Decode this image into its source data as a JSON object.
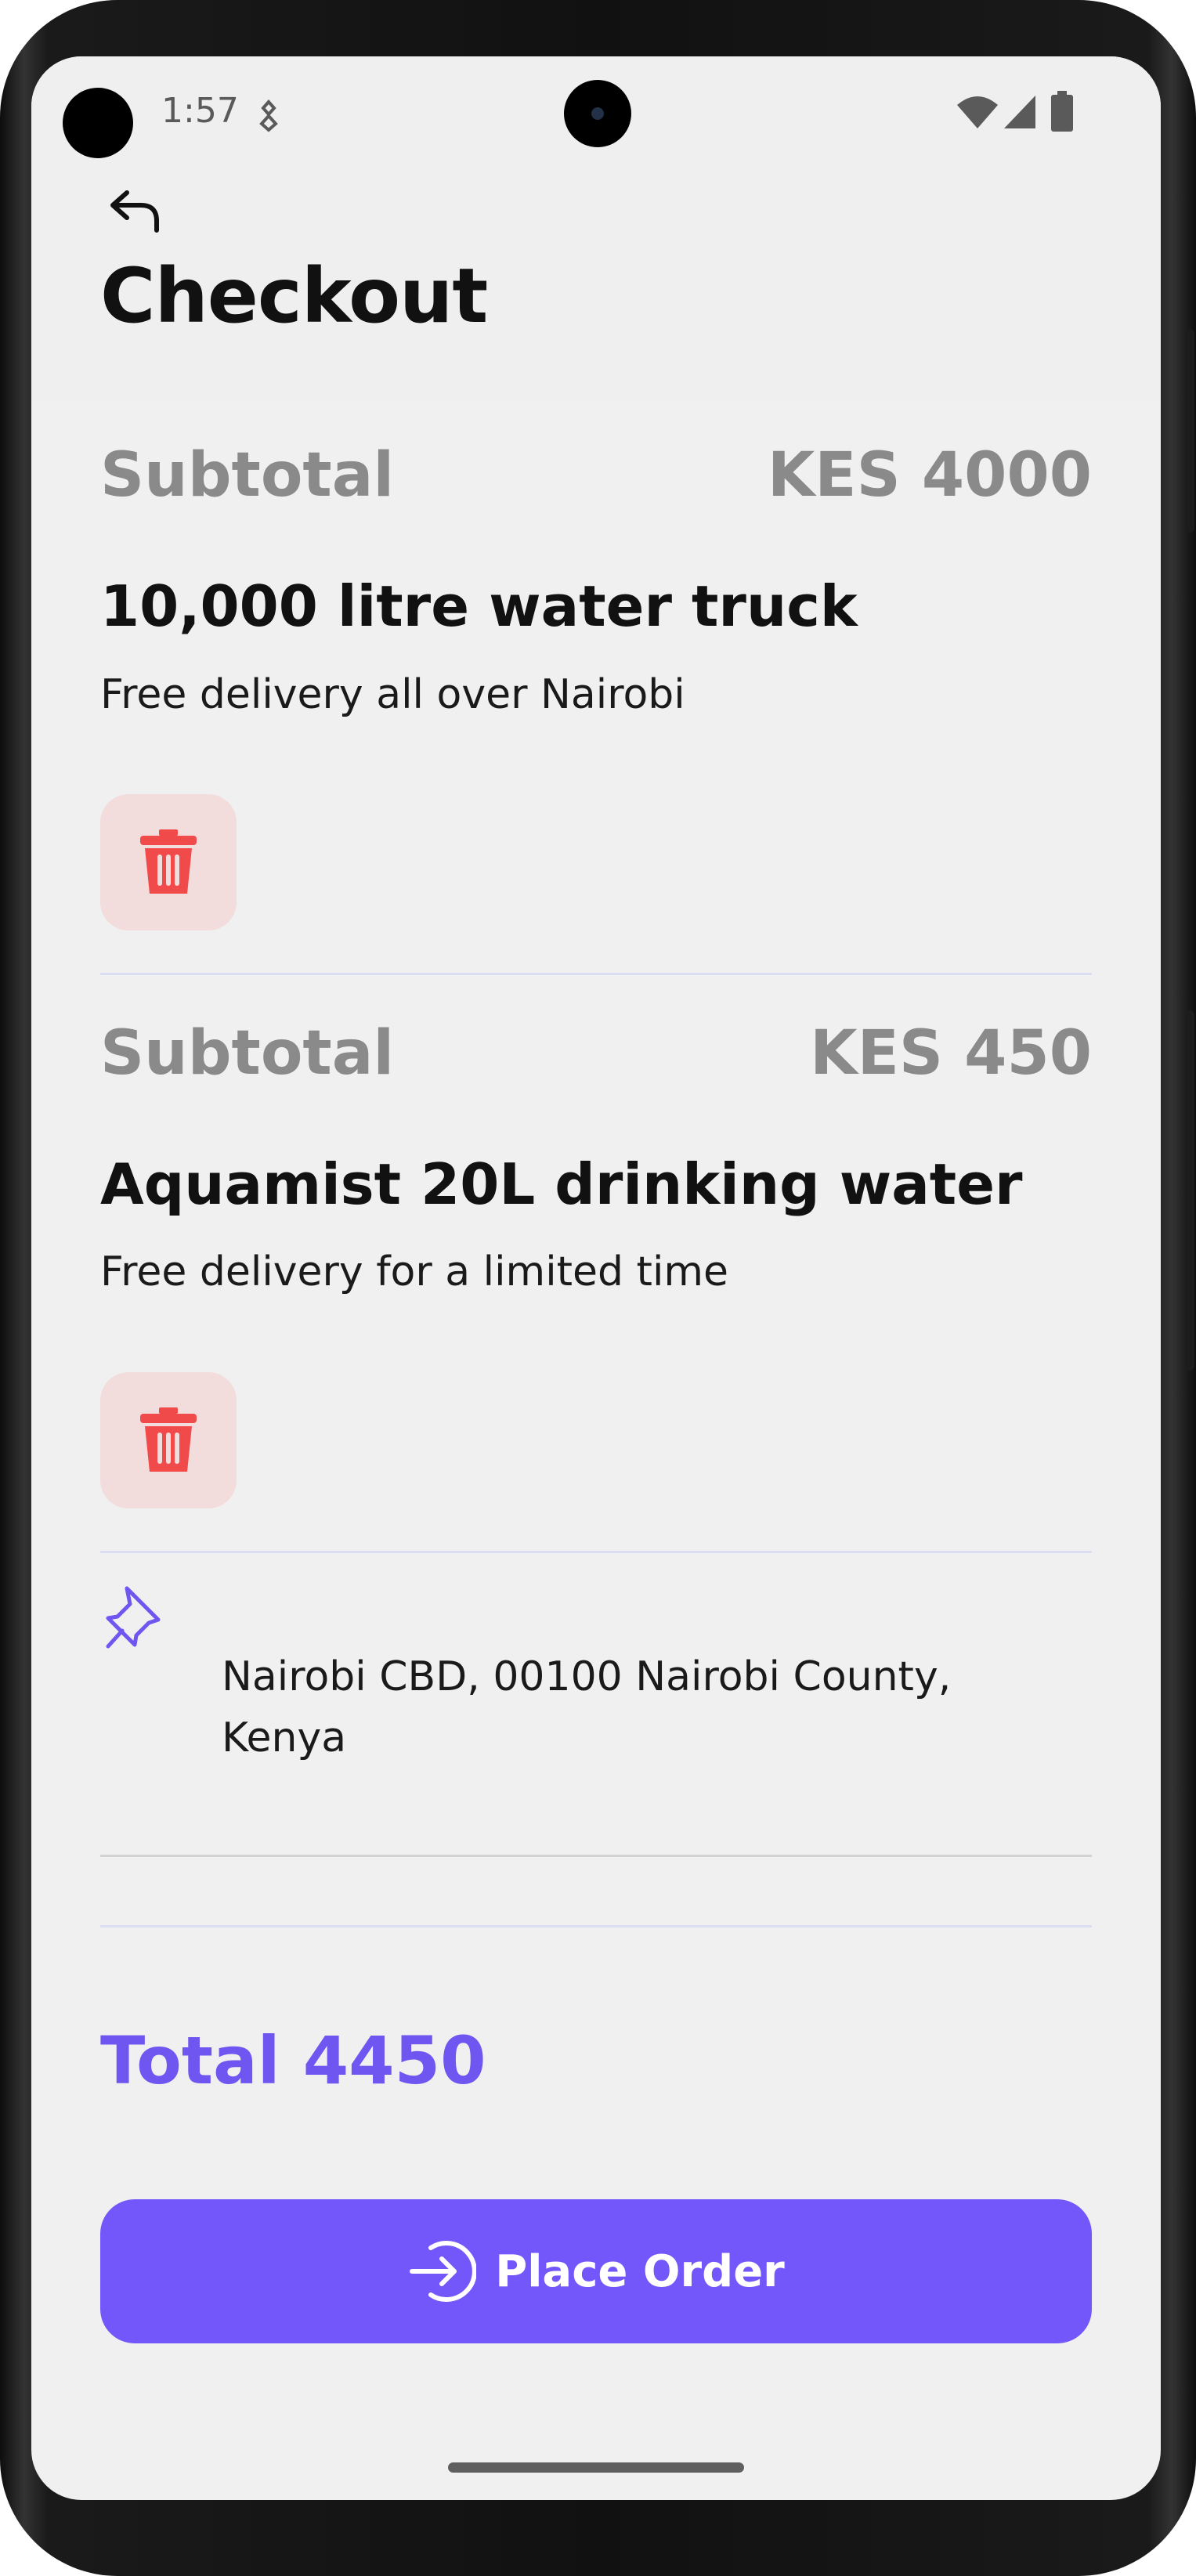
{
  "status_bar": {
    "time": "1:57"
  },
  "header": {
    "title": "Checkout"
  },
  "cart": {
    "items": [
      {
        "subtotal_label": "Subtotal",
        "subtotal_value": "KES 4000",
        "name": "10,000 litre water truck",
        "description": "Free delivery all over Nairobi",
        "delete_icon": "trash-icon"
      },
      {
        "subtotal_label": "Subtotal",
        "subtotal_value": "KES 450",
        "name": "Aquamist 20L drinking water",
        "description": "Free delivery for a limited time",
        "delete_icon": "trash-icon"
      }
    ]
  },
  "delivery": {
    "icon": "pin-icon",
    "address": "Nairobi CBD, 00100 Nairobi County, Kenya"
  },
  "summary": {
    "total_label": "Total 4450"
  },
  "actions": {
    "place_order_label": "Place Order",
    "place_order_icon": "login-arrow-icon"
  },
  "colors": {
    "accent": "#7357fb",
    "total_text": "#6f56f1",
    "delete_bg": "#f3dcdc",
    "delete_icon": "#f04a4a",
    "muted_text": "#8a8a8a",
    "screen_bg": "#f0f0f0"
  }
}
